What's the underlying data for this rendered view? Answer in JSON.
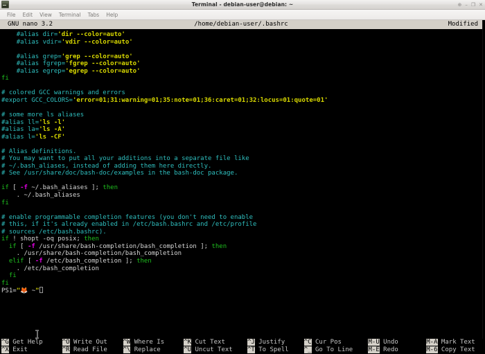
{
  "window": {
    "title": "Terminal - debian-user@debian: ~",
    "icon": "terminal-icon",
    "controls": [
      {
        "name": "shade-button",
        "glyph": "⊕"
      },
      {
        "name": "minimize-button",
        "glyph": "–"
      },
      {
        "name": "maximize-button",
        "glyph": "❐"
      },
      {
        "name": "close-button",
        "glyph": "✕"
      }
    ]
  },
  "menubar": {
    "items": [
      {
        "name": "menu-file",
        "label": "File"
      },
      {
        "name": "menu-edit",
        "label": "Edit"
      },
      {
        "name": "menu-view",
        "label": "View"
      },
      {
        "name": "menu-terminal",
        "label": "Terminal"
      },
      {
        "name": "menu-tabs",
        "label": "Tabs"
      },
      {
        "name": "menu-help",
        "label": "Help"
      }
    ]
  },
  "nano": {
    "version_label": "GNU nano 3.2",
    "filename": "/home/debian-user/.bashrc",
    "status": "Modified",
    "lines": [
      [
        {
          "t": "    ",
          "c": "plain"
        },
        {
          "t": "#alias dir=",
          "c": "comment"
        },
        {
          "t": "'dir --color=auto'",
          "c": "string"
        }
      ],
      [
        {
          "t": "    ",
          "c": "plain"
        },
        {
          "t": "#alias vdir=",
          "c": "comment"
        },
        {
          "t": "'vdir --color=auto'",
          "c": "string"
        }
      ],
      [
        {
          "t": "",
          "c": "plain"
        }
      ],
      [
        {
          "t": "    ",
          "c": "plain"
        },
        {
          "t": "#alias grep=",
          "c": "comment"
        },
        {
          "t": "'grep --color=auto'",
          "c": "string"
        }
      ],
      [
        {
          "t": "    ",
          "c": "plain"
        },
        {
          "t": "#alias fgrep=",
          "c": "comment"
        },
        {
          "t": "'fgrep --color=auto'",
          "c": "string"
        }
      ],
      [
        {
          "t": "    ",
          "c": "plain"
        },
        {
          "t": "#alias egrep=",
          "c": "comment"
        },
        {
          "t": "'egrep --color=auto'",
          "c": "string"
        }
      ],
      [
        {
          "t": "fi",
          "c": "kw"
        }
      ],
      [
        {
          "t": "",
          "c": "plain"
        }
      ],
      [
        {
          "t": "# colored GCC warnings and errors",
          "c": "comment"
        }
      ],
      [
        {
          "t": "#export GCC_COLORS=",
          "c": "comment"
        },
        {
          "t": "'error=01;31:warning=01;35:note=01;36:caret=01;32:locus=01:quote=01'",
          "c": "string"
        }
      ],
      [
        {
          "t": "",
          "c": "plain"
        }
      ],
      [
        {
          "t": "# some more ls aliases",
          "c": "comment"
        }
      ],
      [
        {
          "t": "#alias ll=",
          "c": "comment"
        },
        {
          "t": "'ls -l'",
          "c": "string"
        }
      ],
      [
        {
          "t": "#alias la=",
          "c": "comment"
        },
        {
          "t": "'ls -A'",
          "c": "string"
        }
      ],
      [
        {
          "t": "#alias l=",
          "c": "comment"
        },
        {
          "t": "'ls -CF'",
          "c": "string"
        }
      ],
      [
        {
          "t": "",
          "c": "plain"
        }
      ],
      [
        {
          "t": "# Alias definitions.",
          "c": "comment"
        }
      ],
      [
        {
          "t": "# You may want to put all your additions into a separate file like",
          "c": "comment"
        }
      ],
      [
        {
          "t": "# ~/.bash_aliases, instead of adding them here directly.",
          "c": "comment"
        }
      ],
      [
        {
          "t": "# See /usr/share/doc/bash-doc/examples in the bash-doc package.",
          "c": "comment"
        }
      ],
      [
        {
          "t": "",
          "c": "plain"
        }
      ],
      [
        {
          "t": "if ",
          "c": "kw"
        },
        {
          "t": "[ ",
          "c": "white"
        },
        {
          "t": "-f",
          "c": "flag"
        },
        {
          "t": " ~/.bash_aliases ",
          "c": "white"
        },
        {
          "t": "]",
          "c": "white"
        },
        {
          "t": "; ",
          "c": "white"
        },
        {
          "t": "then",
          "c": "kw"
        }
      ],
      [
        {
          "t": "    . ~/.bash_aliases",
          "c": "white"
        }
      ],
      [
        {
          "t": "fi",
          "c": "kw"
        }
      ],
      [
        {
          "t": "",
          "c": "plain"
        }
      ],
      [
        {
          "t": "# enable programmable completion features (you don't need to enable",
          "c": "comment"
        }
      ],
      [
        {
          "t": "# this, if it's already enabled in /etc/bash.bashrc and /etc/profile",
          "c": "comment"
        }
      ],
      [
        {
          "t": "# sources /etc/bash.bashrc).",
          "c": "comment"
        }
      ],
      [
        {
          "t": "if",
          "c": "kw"
        },
        {
          "t": " ! shopt -oq posix",
          "c": "white"
        },
        {
          "t": "; ",
          "c": "white"
        },
        {
          "t": "then",
          "c": "kw"
        }
      ],
      [
        {
          "t": "  ",
          "c": "plain"
        },
        {
          "t": "if ",
          "c": "kw"
        },
        {
          "t": "[ ",
          "c": "white"
        },
        {
          "t": "-f",
          "c": "flag"
        },
        {
          "t": " /usr/share/bash-completion/bash_completion ]; ",
          "c": "white"
        },
        {
          "t": "then",
          "c": "kw"
        }
      ],
      [
        {
          "t": "    . /usr/share/bash-completion/bash_completion",
          "c": "white"
        }
      ],
      [
        {
          "t": "  ",
          "c": "plain"
        },
        {
          "t": "elif ",
          "c": "kw"
        },
        {
          "t": "[ ",
          "c": "white"
        },
        {
          "t": "-f",
          "c": "flag"
        },
        {
          "t": " /etc/bash_completion ]; ",
          "c": "white"
        },
        {
          "t": "then",
          "c": "kw"
        }
      ],
      [
        {
          "t": "    . /etc/bash_completion",
          "c": "white"
        }
      ],
      [
        {
          "t": "  ",
          "c": "plain"
        },
        {
          "t": "fi",
          "c": "kw"
        }
      ],
      [
        {
          "t": "fi",
          "c": "kw"
        }
      ]
    ],
    "ps1_line": {
      "prefix": "PS1=",
      "quote_open": "\"",
      "emoji": "🦊",
      "middle": " ~",
      "quote_close": "\"",
      "cursor": "block-cursor"
    },
    "shortcuts": [
      [
        {
          "key": "^G",
          "label": " Get Help"
        },
        {
          "key": "^X",
          "label": " Exit"
        }
      ],
      [
        {
          "key": "^O",
          "label": " Write Out"
        },
        {
          "key": "^R",
          "label": " Read File"
        }
      ],
      [
        {
          "key": "^W",
          "label": " Where Is"
        },
        {
          "key": "^\\",
          "label": " Replace"
        }
      ],
      [
        {
          "key": "^K",
          "label": " Cut Text"
        },
        {
          "key": "^U",
          "label": " Uncut Text"
        }
      ],
      [
        {
          "key": "^J",
          "label": " Justify"
        },
        {
          "key": "^T",
          "label": " To Spell"
        }
      ],
      [
        {
          "key": "^C",
          "label": " Cur Pos"
        },
        {
          "key": "^_",
          "label": " Go To Line"
        }
      ],
      [
        {
          "key": "M-U",
          "label": " Undo"
        },
        {
          "key": "M-E",
          "label": " Redo"
        }
      ],
      [
        {
          "key": "M-A",
          "label": " Mark Text"
        },
        {
          "key": "M-6",
          "label": " Copy Text"
        }
      ]
    ]
  },
  "colors": {
    "terminal_bg": "#000000",
    "comment": "#2fbfbf",
    "string": "#dada00",
    "keyword": "#1fc01f",
    "flag": "#e000e0",
    "reverse_bg": "#d4d0c8"
  }
}
